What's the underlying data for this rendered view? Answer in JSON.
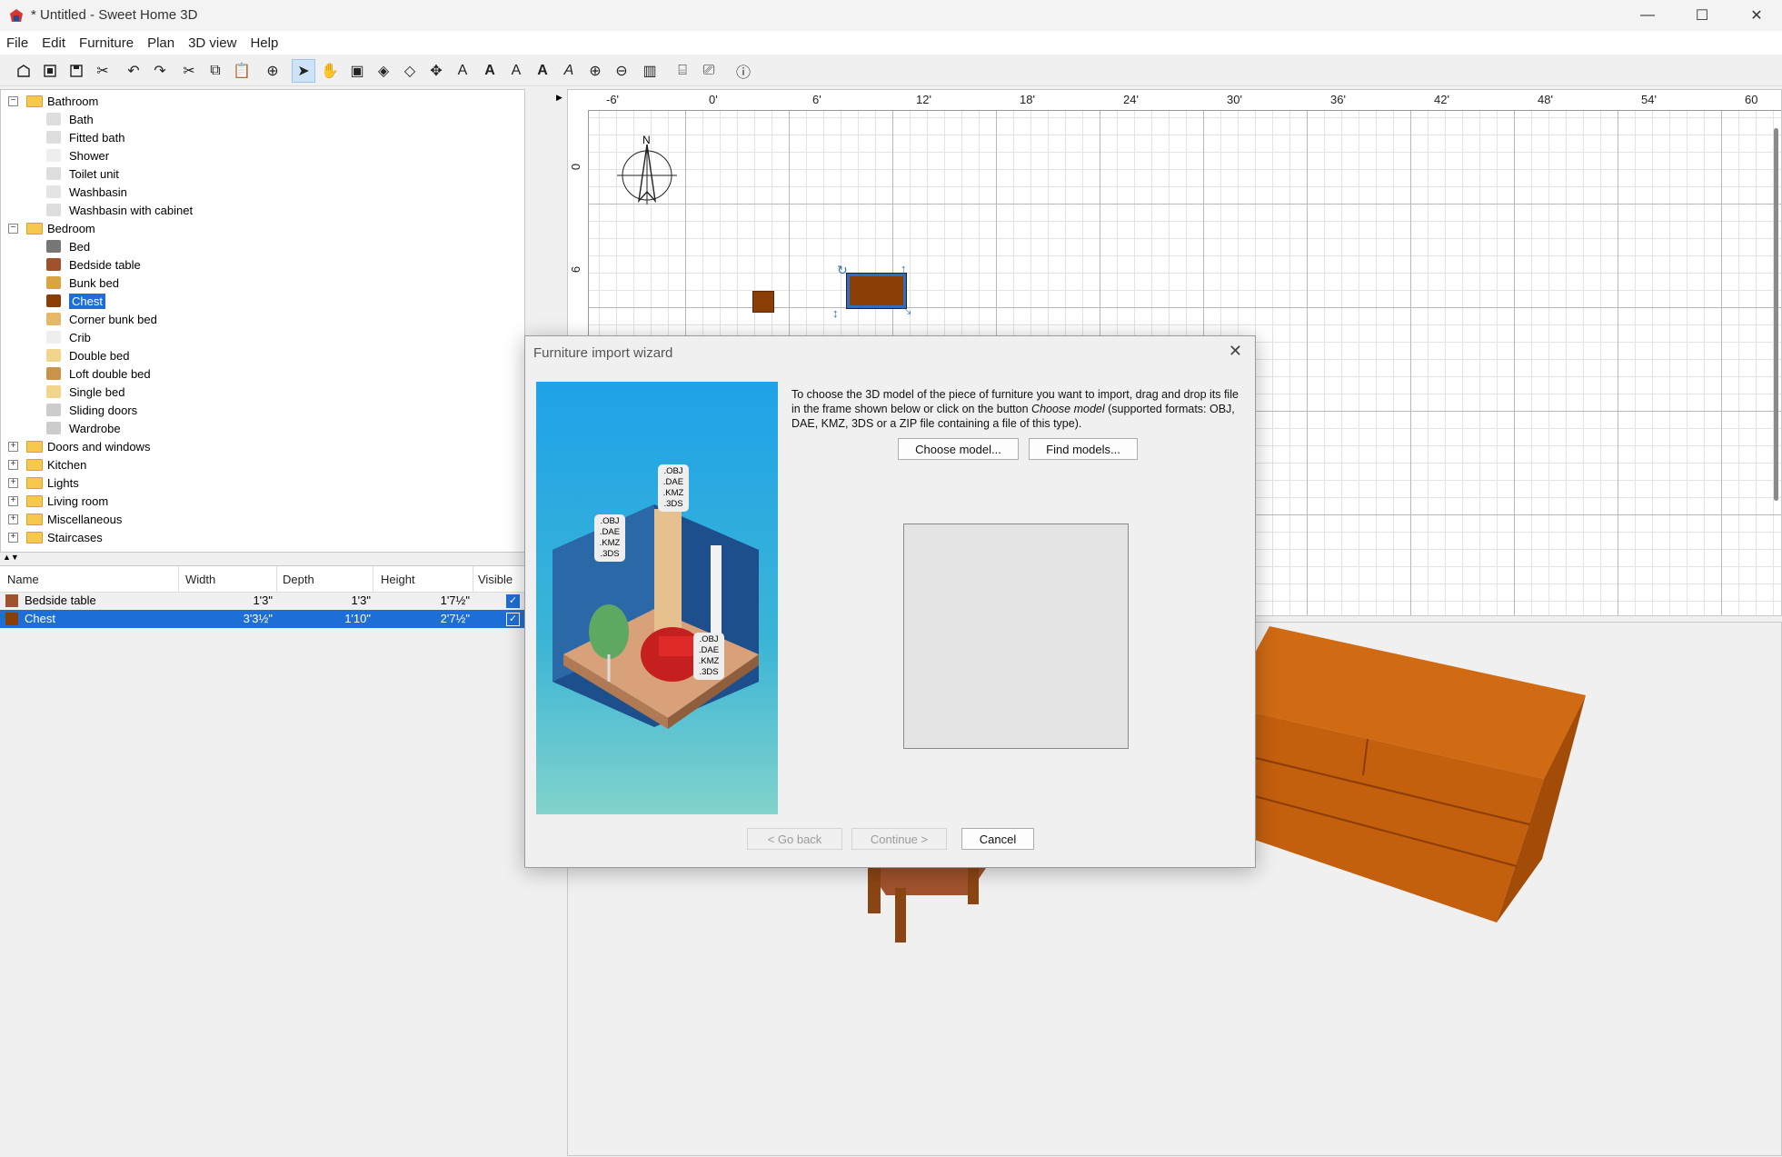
{
  "window": {
    "title": "* Untitled - Sweet Home 3D",
    "minimize": "—",
    "maximize": "☐",
    "close": "✕"
  },
  "menu": [
    "File",
    "Edit",
    "Furniture",
    "Plan",
    "3D view",
    "Help"
  ],
  "toolbar_icons": [
    "new-home-icon",
    "open-icon",
    "save-icon",
    "cut-furniture-icon",
    "undo-icon",
    "redo-icon",
    "cut-icon",
    "copy-icon",
    "paste-icon",
    "add-furniture-icon",
    "select-mode-icon",
    "pan-mode-icon",
    "create-walls-icon",
    "create-rooms-icon",
    "create-polylines-icon",
    "create-dimensions-icon",
    "create-labels-icon",
    "increase-text-icon",
    "decrease-text-icon",
    "bold-icon",
    "italic-icon",
    "zoom-in-icon",
    "zoom-out-icon",
    "import-background-icon",
    "create-photo-icon",
    "create-video-icon",
    "help-icon"
  ],
  "catalog": {
    "categories": [
      {
        "label": "Bathroom",
        "expanded": true,
        "items": [
          "Bath",
          "Fitted bath",
          "Shower",
          "Toilet unit",
          "Washbasin",
          "Washbasin with cabinet"
        ]
      },
      {
        "label": "Bedroom",
        "expanded": true,
        "items": [
          "Bed",
          "Bedside table",
          "Bunk bed",
          "Chest",
          "Corner bunk bed",
          "Crib",
          "Double bed",
          "Loft double bed",
          "Single bed",
          "Sliding doors",
          "Wardrobe"
        ]
      },
      {
        "label": "Doors and windows",
        "expanded": false,
        "items": []
      },
      {
        "label": "Kitchen",
        "expanded": false,
        "items": []
      },
      {
        "label": "Lights",
        "expanded": false,
        "items": []
      },
      {
        "label": "Living room",
        "expanded": false,
        "items": []
      },
      {
        "label": "Miscellaneous",
        "expanded": false,
        "items": []
      },
      {
        "label": "Staircases",
        "expanded": false,
        "items": []
      }
    ],
    "selected_item": "Chest"
  },
  "furniture_table": {
    "columns": [
      "Name",
      "Width",
      "Depth",
      "Height",
      "Visible"
    ],
    "rows": [
      {
        "name": "Bedside table",
        "width": "1'3\"",
        "depth": "1'3\"",
        "height": "1'7½\"",
        "visible": true,
        "selected": false
      },
      {
        "name": "Chest",
        "width": "3'3½\"",
        "depth": "1'10\"",
        "height": "2'7½\"",
        "visible": true,
        "selected": true
      }
    ]
  },
  "plan": {
    "ruler_top": [
      "-6'",
      "0'",
      "6'",
      "12'",
      "18'",
      "24'",
      "30'",
      "36'",
      "42'",
      "48'",
      "54'",
      "60"
    ],
    "ruler_left": [
      "0",
      "6"
    ],
    "compass_label": "N"
  },
  "dialog": {
    "title": "Furniture import wizard",
    "instructions_1": "To choose the 3D model of the piece of furniture you want to import, drag and drop its file in the frame shown below or click on the button ",
    "instructions_em": "Choose model",
    "instructions_2": " (supported formats: OBJ, DAE, KMZ, 3DS or a ZIP file containing a file of this type).",
    "choose_model": "Choose model...",
    "find_models": "Find models...",
    "go_back": "< Go back",
    "continue": "Continue >",
    "cancel": "Cancel",
    "format_tags": [
      ".OBJ",
      ".DAE",
      ".KMZ",
      ".3DS"
    ]
  },
  "colors": {
    "accent": "#1e6ed8",
    "chest": "#c8600f",
    "plan_chest": "#8b3d06"
  }
}
